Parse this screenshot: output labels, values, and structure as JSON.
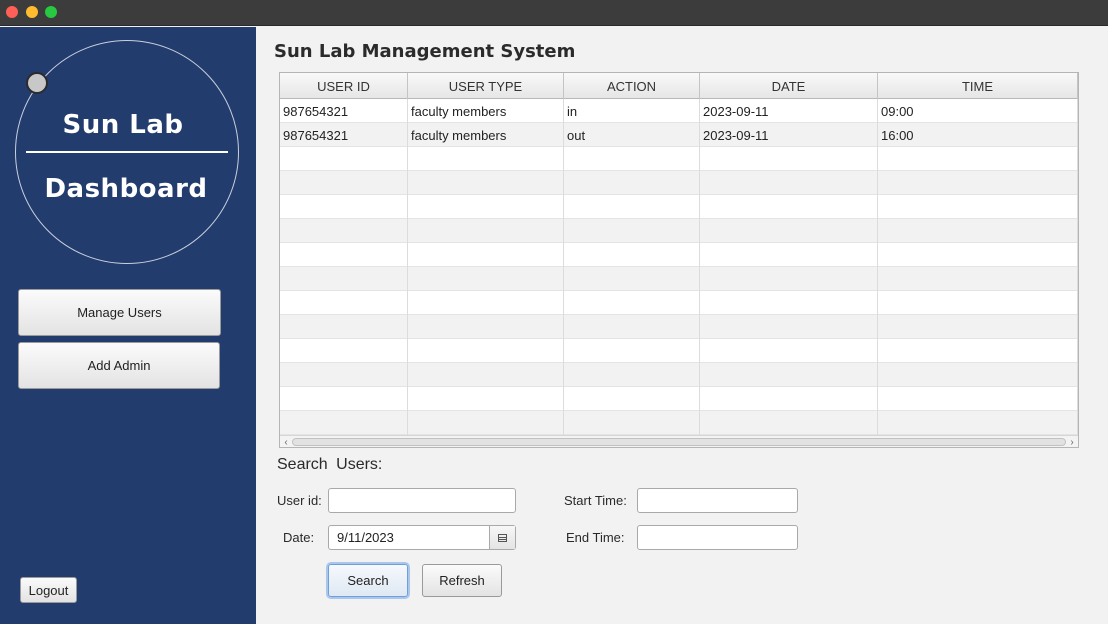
{
  "sidebar": {
    "brand_top": "Sun Lab",
    "brand_bottom": "Dashboard",
    "buttons": [
      {
        "label": "Manage Users"
      },
      {
        "label": "Add Admin"
      }
    ],
    "logout_label": "Logout"
  },
  "main": {
    "title": "Sun Lab Management System",
    "table": {
      "columns": [
        "USER ID",
        "USER TYPE",
        "ACTION",
        "DATE",
        "TIME"
      ],
      "rows": [
        [
          "987654321",
          "faculty members",
          "in",
          "2023-09-11",
          "09:00"
        ],
        [
          "987654321",
          "faculty members",
          "out",
          "2023-09-11",
          "16:00"
        ]
      ]
    },
    "search": {
      "heading": "Search Users:",
      "user_id_label": "User id:",
      "user_id_value": "",
      "date_label": "Date:",
      "date_value": "9/11/2023",
      "start_time_label": "Start Time:",
      "start_time_value": "",
      "end_time_label": "End Time:",
      "end_time_value": "",
      "search_button": "Search",
      "refresh_button": "Refresh"
    }
  },
  "icons": {
    "window_controls": [
      "close-icon",
      "minimize-icon",
      "zoom-icon"
    ],
    "date_picker": "calendar-icon",
    "scroll": [
      "chevron-left-icon",
      "chevron-right-icon"
    ]
  },
  "colors": {
    "sidebar": "#233c6e",
    "focus_ring": "#a9c7ec"
  }
}
